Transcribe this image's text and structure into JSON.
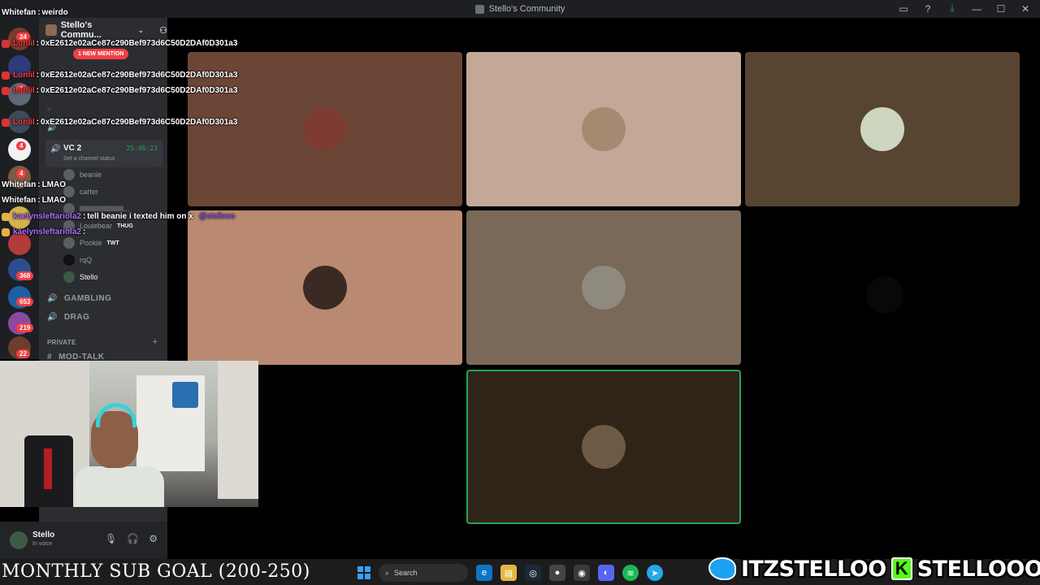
{
  "window": {
    "title": "Stello's Community",
    "controls": [
      "inbox-icon",
      "help-icon",
      "download-icon",
      "minimize",
      "maximize",
      "close"
    ]
  },
  "server_badges": [
    "24",
    "1",
    "4",
    "4",
    "368",
    "653",
    "219",
    "22"
  ],
  "channel_sidebar": {
    "server_name": "Stello's Commu...",
    "new_mention": "1 NEW MENTION",
    "voice_channel": {
      "name": "VC 2",
      "timer": "25:46:23",
      "status_placeholder": "Set a channel status"
    },
    "members": [
      {
        "name": "beanie",
        "tag": ""
      },
      {
        "name": "carter",
        "tag": ""
      },
      {
        "name": "lllllllllllllllllllllllllll...",
        "tag": ""
      },
      {
        "name": "Louiebear",
        "tag": "THUG"
      },
      {
        "name": "Pookie",
        "tag": "TWT"
      },
      {
        "name": "rqQ",
        "tag": ""
      },
      {
        "name": "Stello",
        "tag": ""
      }
    ],
    "channels": [
      "GAMBLING",
      "DRAG"
    ],
    "category": "PRIVATE",
    "next_channel": "MOD-TALK"
  },
  "user_panel": {
    "username": "Stello",
    "status": "In voice"
  },
  "chat": [
    {
      "user": "Whitefan",
      "color": "#ffffff",
      "text": "weirdo"
    },
    {
      "user": "Lonlil",
      "color": "#ff3b3b",
      "text": "0xE2612e02aCe87c290Bef973d6C50D2DAf0D301a3"
    },
    {
      "user": "Lonlil",
      "color": "#ff3b3b",
      "text": "0xE2612e02aCe87c290Bef973d6C50D2DAf0D301a3"
    },
    {
      "user": "Lonlil",
      "color": "#ff3b3b",
      "text": "0xE2612e02aCe87c290Bef973d6C50D2DAf0D301a3"
    },
    {
      "user": "Lonlil",
      "color": "#ff3b3b",
      "text": "0xE2612e02aCe87c290Bef973d6C50D2DAf0D301a3"
    },
    {
      "user": "Whitefan",
      "color": "#ffffff",
      "text": "LMAO"
    },
    {
      "user": "Whitefan",
      "color": "#ffffff",
      "text": "LMAO"
    },
    {
      "user": "kaelynsleftariola2",
      "color": "#b36bff",
      "text": "tell beanie i texted him on x",
      "mention": "@stellooo"
    },
    {
      "user": "kaelynsleftariola2",
      "color": "#b36bff",
      "text": ""
    }
  ],
  "tiles": [
    {
      "bg": "#6b4636",
      "avatar_bg": "#7d3b32",
      "speaking": false
    },
    {
      "bg": "#c4a897",
      "avatar_bg": "#a58a72",
      "speaking": false
    },
    {
      "bg": "#574531",
      "avatar_bg": "#cfd6bf",
      "speaking": false
    },
    {
      "bg": "#b98a71",
      "avatar_bg": "#3b2a24",
      "speaking": false
    },
    {
      "bg": "#7a6859",
      "avatar_bg": "#8f8a7e",
      "speaking": false
    },
    {
      "bg": "#302318",
      "avatar_bg": "#6d5a44",
      "speaking": true
    }
  ],
  "taskbar": {
    "sub_goal": "MONTHLY SUB GOAL (200-250)",
    "search_placeholder": "Search"
  },
  "socials": {
    "twitter": "ITZSTELLOO",
    "kick": "STELLOOO"
  }
}
